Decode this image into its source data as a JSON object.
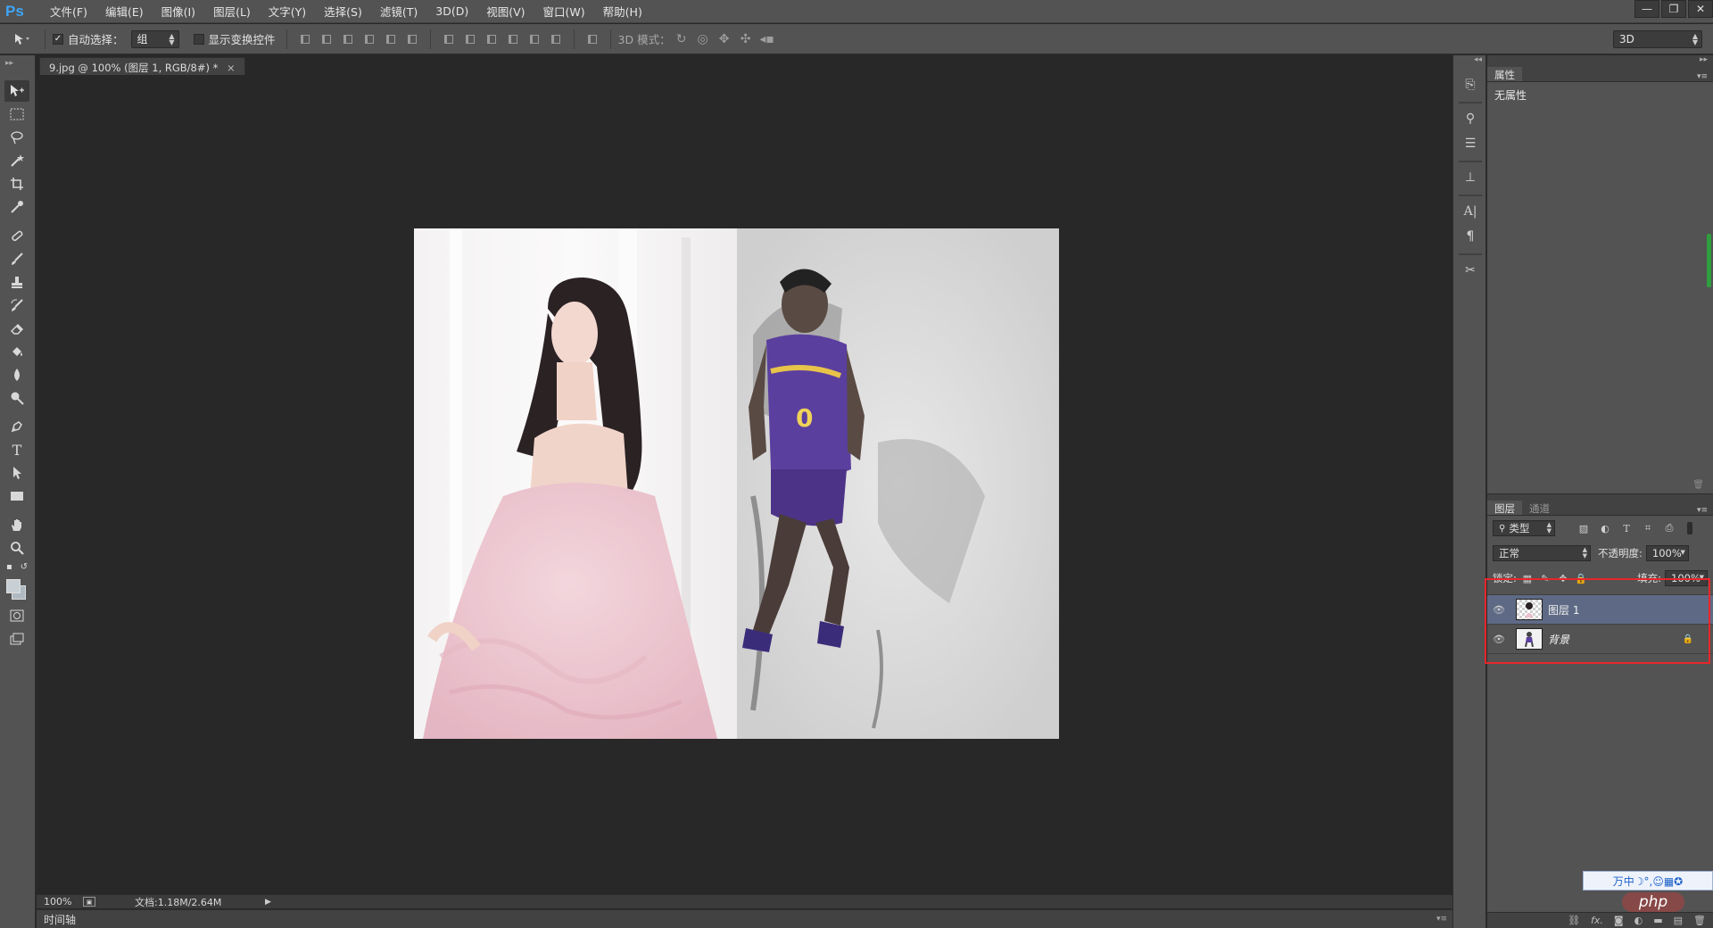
{
  "app": {
    "logo": "Ps"
  },
  "menu": [
    "文件(F)",
    "编辑(E)",
    "图像(I)",
    "图层(L)",
    "文字(Y)",
    "选择(S)",
    "滤镜(T)",
    "3D(D)",
    "视图(V)",
    "窗口(W)",
    "帮助(H)"
  ],
  "window_controls": [
    "—",
    "❐",
    "✕"
  ],
  "options": {
    "auto_select_label": "自动选择：",
    "auto_select_value": "组",
    "show_transform_label": "显示变换控件",
    "mode3d_label": "3D 模式：",
    "workspace_value": "3D"
  },
  "document": {
    "tab_title": "9.jpg @ 100% (图层 1, RGB/8#) *",
    "close_glyph": "×"
  },
  "status": {
    "zoom": "100%",
    "doc_info": "文档:1.18M/2.64M"
  },
  "timeline": {
    "label": "时间轴"
  },
  "properties": {
    "tab": "属性",
    "content": "无属性"
  },
  "layers": {
    "tabs": [
      "图层",
      "通道"
    ],
    "filter_value": "类型",
    "blend_mode": "正常",
    "opacity_label": "不透明度:",
    "opacity_value": "100%",
    "lock_label": "锁定:",
    "fill_label": "填充:",
    "fill_value": "100%",
    "items": [
      {
        "name": "图层 1",
        "selected": true,
        "locked": false
      },
      {
        "name": "背景",
        "selected": false,
        "locked": true
      }
    ]
  },
  "overlay": {
    "ime_text": "万中☽°,☺▦✪",
    "watermark": "php"
  },
  "colors": {
    "chrome": "#535353",
    "canvas_bg": "#282828",
    "selection": "#5e6a85",
    "highlight_box": "#e8262b"
  }
}
